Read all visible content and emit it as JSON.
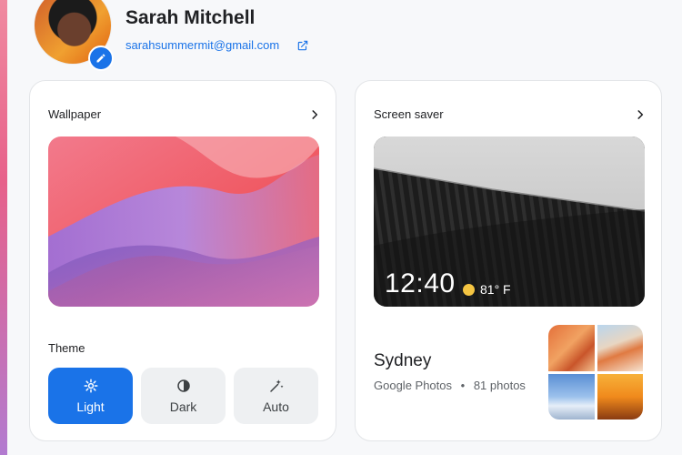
{
  "profile": {
    "name": "Sarah Mitchell",
    "email": "sarahsummermit@gmail.com",
    "avatar_icon": "avatar-photo",
    "edit_icon": "pencil-icon",
    "external_icon": "open-external-icon"
  },
  "wallpaper_card": {
    "title": "Wallpaper",
    "chevron": "chevron-right-icon",
    "theme_label": "Theme",
    "theme_options": [
      {
        "label": "Light",
        "icon": "gear-icon",
        "selected": true
      },
      {
        "label": "Dark",
        "icon": "half-circle-icon",
        "selected": false
      },
      {
        "label": "Auto",
        "icon": "sparkle-wand-icon",
        "selected": false
      }
    ]
  },
  "screensaver_card": {
    "title": "Screen saver",
    "chevron": "chevron-right-icon",
    "preview_time": "12:40",
    "preview_temp": "81° F",
    "album_title": "Sydney",
    "album_source": "Google Photos",
    "album_count": "81 photos",
    "album_separator": "•"
  },
  "colors": {
    "accent": "#1a73e8",
    "card_bg": "#ffffff",
    "page_bg": "#f7f8fa",
    "inactive_button": "#eef0f2"
  }
}
